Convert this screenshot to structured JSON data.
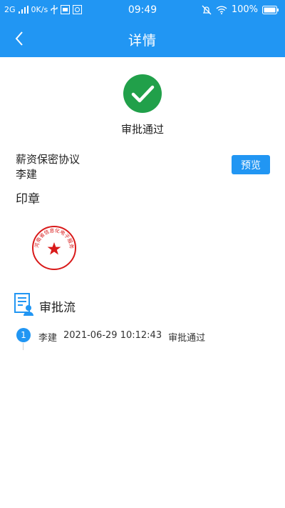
{
  "status_bar": {
    "network": "2G",
    "speed": "0K/s",
    "time": "09:49",
    "battery": "100%",
    "icons": [
      "signal-icon",
      "usb-icon",
      "notification-icon",
      "alarm-off-icon",
      "wifi-icon",
      "battery-icon"
    ]
  },
  "header": {
    "title": "详情",
    "back_icon": "chevron-left-icon"
  },
  "approval": {
    "status": "审批通过",
    "status_icon": "check-circle-icon",
    "status_color": "#21a04a"
  },
  "document": {
    "title": "薪资保密协议",
    "signer": "李建",
    "preview_label": "预览"
  },
  "seal": {
    "label": "印章",
    "text": "河南省信息化电子服务有限公司",
    "color": "#d91a1a"
  },
  "flow": {
    "label": "审批流",
    "entries": [
      {
        "step": "1",
        "name": "李建",
        "datetime": "2021-06-29 10:12:43",
        "result": "审批通过"
      }
    ]
  },
  "colors": {
    "primary": "#2196f3",
    "success": "#21a04a"
  }
}
